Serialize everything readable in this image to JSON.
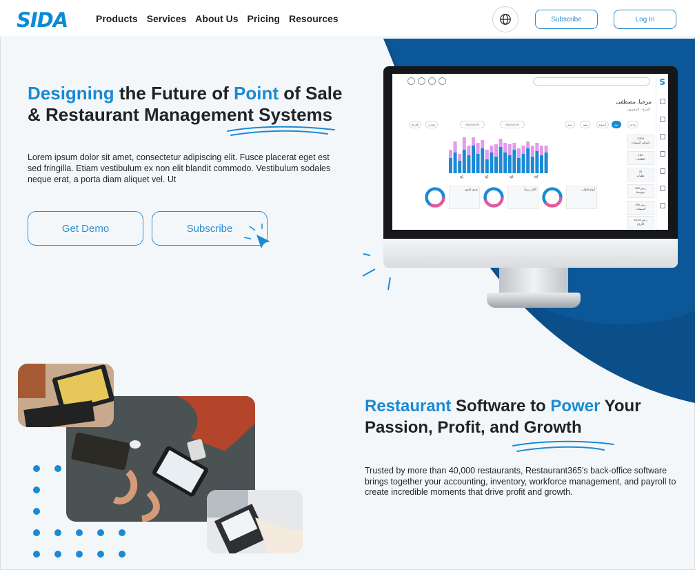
{
  "header": {
    "logo": "SIDA",
    "nav": [
      "Products",
      "Services",
      "About Us",
      "Pricing",
      "Resources"
    ],
    "subscribe_label": "Subscribe",
    "login_label": "Log In"
  },
  "hero": {
    "title_parts": [
      "Designing",
      " the Future of ",
      "Point",
      " of Sale & Restaurant Management Systems"
    ],
    "text": "Lorem ipsum dolor sit amet, consectetur adipiscing elit. Fusce placerat eget est sed fringilla. Etiam vestibulum ex non elit blandit commodo. Vestibulum sodales neque erat, a porta diam aliquet vel. Ut",
    "demo_label": "Get Demo",
    "subscribe_label": "Subscribe"
  },
  "dashboard": {
    "logo": "S",
    "user_name": "مرحبا, مصطفى",
    "user_sub": "الفرع · المخزون",
    "filters": [
      "ساعة",
      "يوم",
      "أسبوع",
      "شهر",
      "سنة"
    ],
    "date_from": "25/02/2025",
    "date_to": "25/02/2025",
    "quarters": [
      "q1",
      "q2",
      "q3",
      "q4"
    ],
    "stats": [
      {
        "value": "3.500",
        "label": "إجمالي المبيعات"
      },
      {
        "value": "150",
        "label": "الطلبات"
      },
      {
        "value": "25",
        "label": "طلبات"
      },
      {
        "value": "350 ر.س",
        "label": "متوسط"
      },
      {
        "value": "150 ر.س",
        "label": "المبيعات"
      },
      {
        "value": "42.15 ر.س",
        "label": "الأرباح"
      }
    ],
    "donut_cards": [
      "أنواع الطلب",
      "الأكثر مبيعاً",
      "طرق الدفع"
    ]
  },
  "section2": {
    "title_parts": [
      "Restaurant",
      " Software to ",
      "Power",
      " Your Passion, Profit, and Growth"
    ],
    "text": "Trusted by more than 40,000 restaurants, Restaurant365's back-office software brings together your accounting, inventory, workforce management, and payroll to create incredible moments that drive profit and growth."
  },
  "colors": {
    "accent": "#1a8ad4",
    "dark_arc": "#0b4f8a",
    "chart_pink": "#e29be8",
    "chart_blue": "#1a8ad4"
  }
}
